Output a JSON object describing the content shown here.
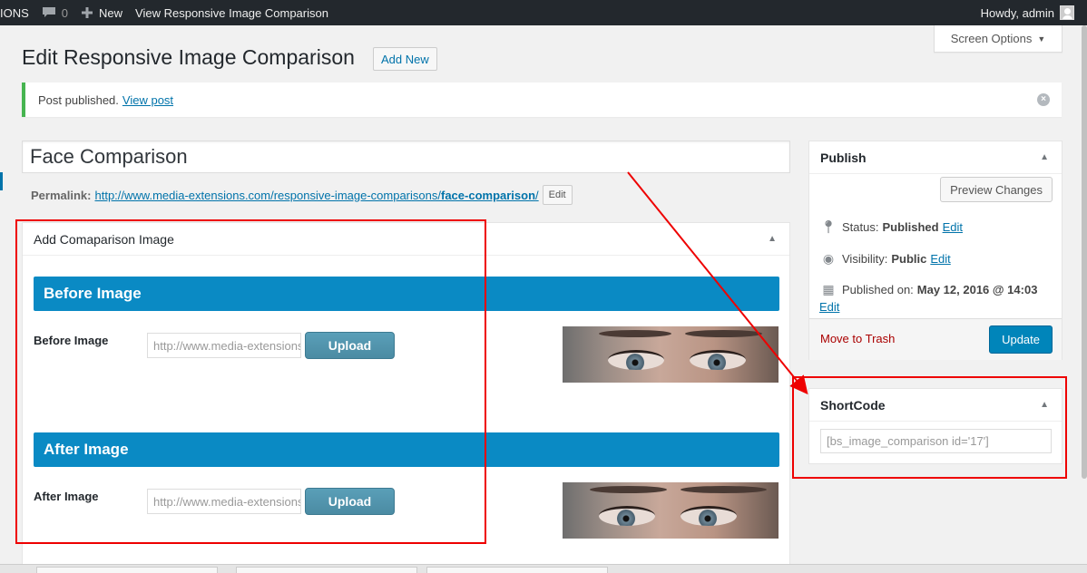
{
  "adminbar": {
    "site_fragment": "IONS",
    "comments_count": "0",
    "new_label": "New",
    "view_label": "View Responsive Image Comparison",
    "greeting": "Howdy, admin"
  },
  "screen_options": "Screen Options",
  "page": {
    "title": "Edit Responsive Image Comparison",
    "add_new": "Add New"
  },
  "notice": {
    "text": "Post published.",
    "link": "View post"
  },
  "post": {
    "title": "Face Comparison",
    "permalink_label": "Permalink:",
    "permalink_base": "http://www.media-extensions.com/responsive-image-comparisons/",
    "permalink_slug": "face-comparison",
    "permalink_trailing": "/",
    "edit_label": "Edit"
  },
  "comparison_box": {
    "title": "Add Comaparison Image",
    "before": {
      "section_title": "Before Image",
      "label": "Before Image",
      "url_value": "http://www.media-extensions.com",
      "upload_label": "Upload"
    },
    "after": {
      "section_title": "After Image",
      "label": "After Image",
      "url_value": "http://www.media-extensions.com",
      "upload_label": "Upload"
    }
  },
  "publish": {
    "title": "Publish",
    "preview_label": "Preview Changes",
    "status_label": "Status:",
    "status_value": "Published",
    "visibility_label": "Visibility:",
    "visibility_value": "Public",
    "published_label": "Published on:",
    "published_value": "May 12, 2016 @ 14:03",
    "edit_label": "Edit",
    "trash_label": "Move to Trash",
    "update_label": "Update"
  },
  "shortcode": {
    "title": "ShortCode",
    "value": "[bs_image_comparison id='17']"
  },
  "colors": {
    "admin_bar": "#23282d",
    "accent_blue": "#0085ba",
    "section_blue": "#0a8ac4",
    "notice_green": "#46b450",
    "annotation_red": "#e00000"
  }
}
